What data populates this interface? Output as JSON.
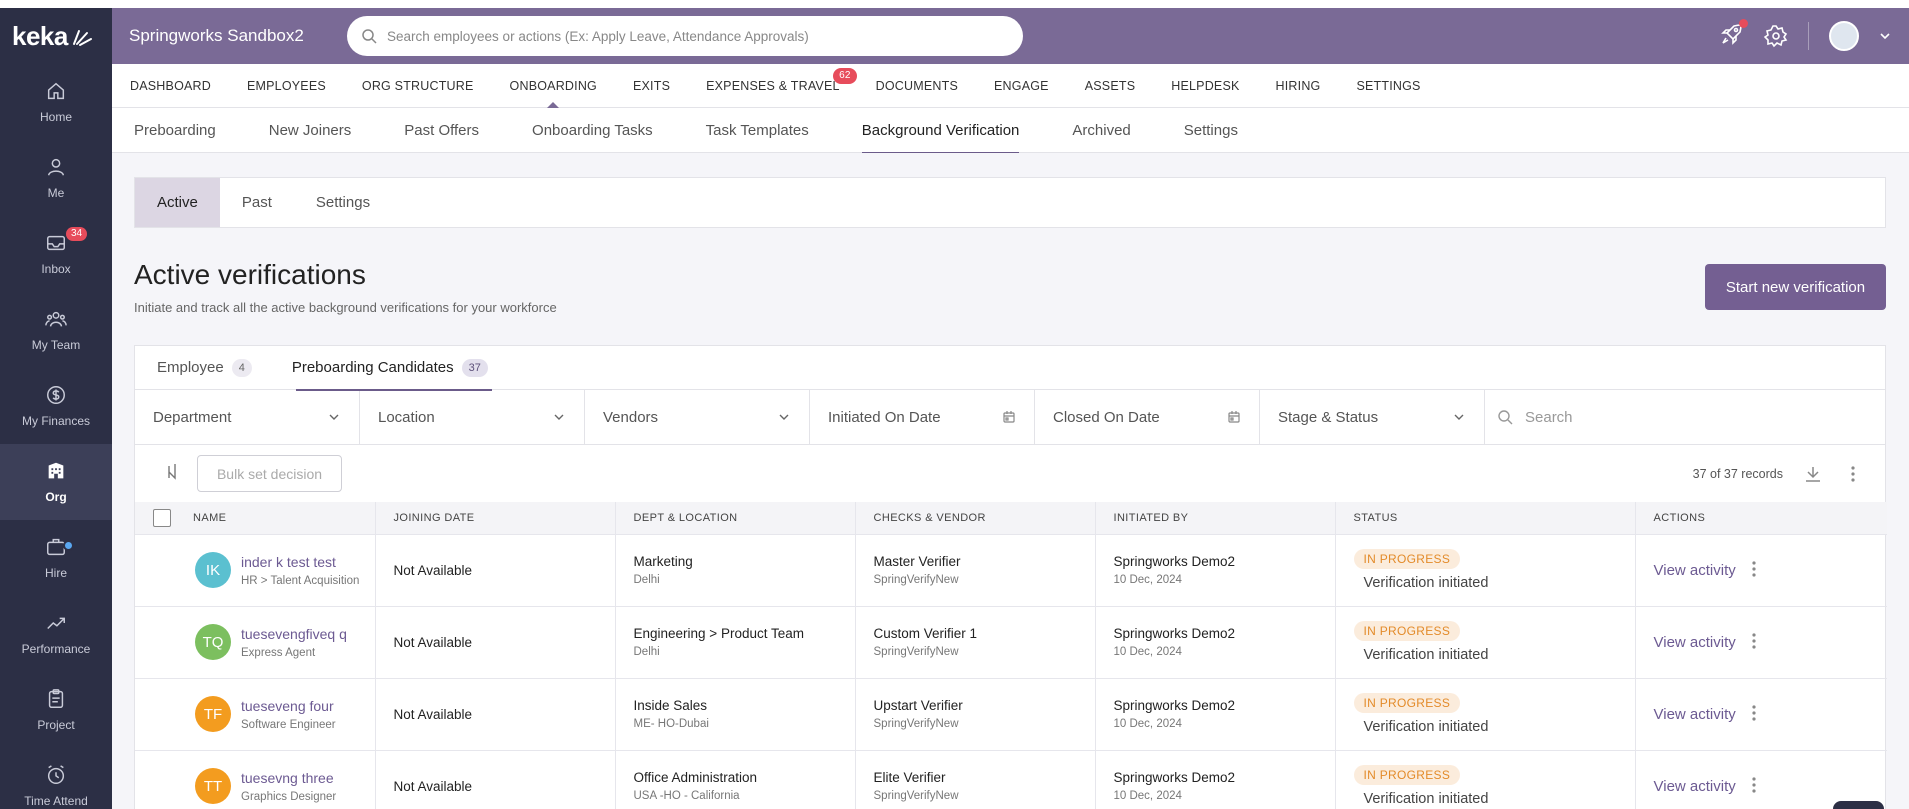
{
  "logo": "keka",
  "sidebar": {
    "items": [
      {
        "label": "Home",
        "icon": "home-icon"
      },
      {
        "label": "Me",
        "icon": "user-icon"
      },
      {
        "label": "Inbox",
        "icon": "inbox-icon",
        "badge": "34"
      },
      {
        "label": "My Team",
        "icon": "team-icon"
      },
      {
        "label": "My Finances",
        "icon": "dollar-icon"
      },
      {
        "label": "Org",
        "icon": "building-icon"
      },
      {
        "label": "Hire",
        "icon": "briefcase-icon"
      },
      {
        "label": "Performance",
        "icon": "trend-icon"
      },
      {
        "label": "Project",
        "icon": "clipboard-icon"
      },
      {
        "label": "Time Attend",
        "icon": "clock-icon"
      }
    ]
  },
  "topbar": {
    "org_name": "Springworks Sandbox2",
    "search_placeholder": "Search employees or actions (Ex: Apply Leave, Attendance Approvals)"
  },
  "modules": [
    {
      "label": "DASHBOARD"
    },
    {
      "label": "EMPLOYEES"
    },
    {
      "label": "ORG STRUCTURE"
    },
    {
      "label": "ONBOARDING"
    },
    {
      "label": "EXITS"
    },
    {
      "label": "EXPENSES & TRAVEL",
      "badge": "62"
    },
    {
      "label": "DOCUMENTS"
    },
    {
      "label": "ENGAGE"
    },
    {
      "label": "ASSETS"
    },
    {
      "label": "HELPDESK"
    },
    {
      "label": "HIRING"
    },
    {
      "label": "SETTINGS"
    }
  ],
  "subnav": [
    "Preboarding",
    "New Joiners",
    "Past Offers",
    "Onboarding Tasks",
    "Task Templates",
    "Background Verification",
    "Archived",
    "Settings"
  ],
  "pill_tabs": [
    "Active",
    "Past",
    "Settings"
  ],
  "page": {
    "title": "Active verifications",
    "subtitle": "Initiate and track all the active background verifications for your workforce",
    "start_button": "Start new verification"
  },
  "content_tabs": [
    {
      "label": "Employee",
      "count": "4"
    },
    {
      "label": "Preboarding Candidates",
      "count": "37"
    }
  ],
  "filters": {
    "department": "Department",
    "location": "Location",
    "vendors": "Vendors",
    "initiated_on": "Initiated On Date",
    "closed_on": "Closed On Date",
    "stage_status": "Stage & Status",
    "search_placeholder": "Search"
  },
  "toolbar": {
    "bulk_button": "Bulk set decision",
    "records": "37 of 37 records"
  },
  "table": {
    "headers": [
      "NAME",
      "JOINING DATE",
      "DEPT & LOCATION",
      "CHECKS & VENDOR",
      "INITIATED BY",
      "STATUS",
      "ACTIONS"
    ],
    "rows": [
      {
        "initials": "IK",
        "color": "#5bc0d0",
        "name": "inder k test test",
        "role": "HR > Talent Acquisition",
        "joining": "Not Available",
        "dept": "Marketing",
        "location": "Delhi",
        "check": "Master Verifier",
        "vendor": "SpringVerifyNew",
        "initiated_by": "Springworks Demo2",
        "initiated_on": "10 Dec, 2024",
        "status_badge": "IN PROGRESS",
        "status_text": "Verification initiated",
        "action": "View activity"
      },
      {
        "initials": "TQ",
        "color": "#7cbf5f",
        "name": "tuesevengfiveq q",
        "role": "Express Agent",
        "joining": "Not Available",
        "dept": "Engineering > Product Team",
        "location": "Delhi",
        "check": "Custom Verifier 1",
        "vendor": "SpringVerifyNew",
        "initiated_by": "Springworks Demo2",
        "initiated_on": "10 Dec, 2024",
        "status_badge": "IN PROGRESS",
        "status_text": "Verification initiated",
        "action": "View activity"
      },
      {
        "initials": "TF",
        "color": "#f39c1f",
        "name": "tueseveng four",
        "role": "Software Engineer",
        "joining": "Not Available",
        "dept": "Inside Sales",
        "location": "ME- HO-Dubai",
        "check": "Upstart Verifier",
        "vendor": "SpringVerifyNew",
        "initiated_by": "Springworks Demo2",
        "initiated_on": "10 Dec, 2024",
        "status_badge": "IN PROGRESS",
        "status_text": "Verification initiated",
        "action": "View activity"
      },
      {
        "initials": "TT",
        "color": "#f39c1f",
        "name": "tuesevng three",
        "role": "Graphics Designer",
        "joining": "Not Available",
        "dept": "Office Administration",
        "location": "USA -HO - California",
        "check": "Elite Verifier",
        "vendor": "SpringVerifyNew",
        "initiated_by": "Springworks Demo2",
        "initiated_on": "10 Dec, 2024",
        "status_badge": "IN PROGRESS",
        "status_text": "Verification initiated",
        "action": "View activity"
      }
    ]
  },
  "colors": {
    "sidebar": "#2c2f45",
    "topbar": "#7a6a96",
    "accent": "#745f92",
    "link": "#6c5a92",
    "badge_red": "#e74c5b",
    "status_orange": "#e38b2a"
  }
}
